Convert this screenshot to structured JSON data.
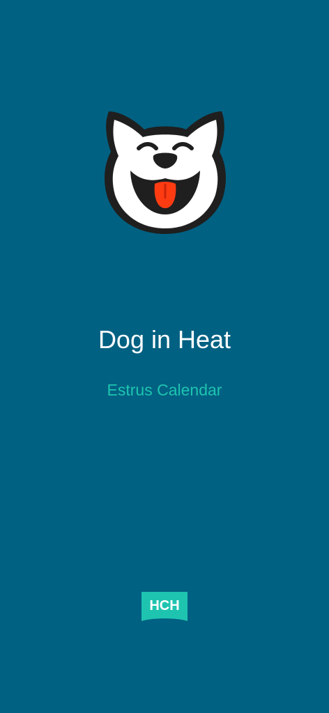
{
  "app": {
    "title": "Dog in Heat",
    "subtitle": "Estrus Calendar"
  },
  "logo": {
    "icon": "dog-face-icon"
  },
  "brand": {
    "label": "HCH",
    "icon": "brand-badge-icon"
  },
  "colors": {
    "background": "#016182",
    "accent": "#1EC4B0",
    "title": "#FFFFFF",
    "tongue": "#FF3B12",
    "outline": "#1F1F1F"
  }
}
